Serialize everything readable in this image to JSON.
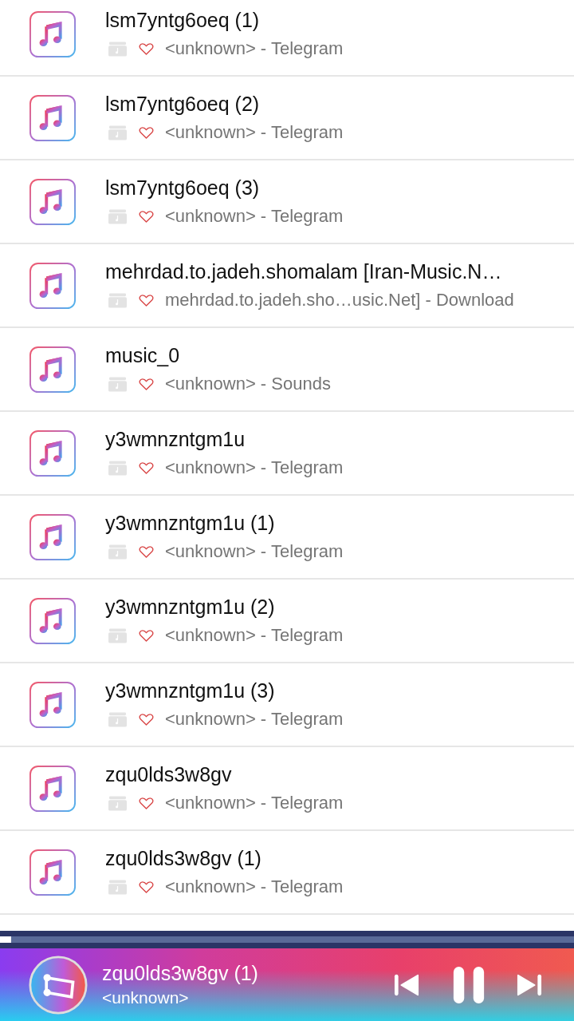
{
  "songs": [
    {
      "title": "lsm7yntg6oeq (1)",
      "subtitle": "<unknown> - Telegram"
    },
    {
      "title": "lsm7yntg6oeq (2)",
      "subtitle": "<unknown> - Telegram"
    },
    {
      "title": "lsm7yntg6oeq (3)",
      "subtitle": "<unknown> - Telegram"
    },
    {
      "title": "mehrdad.to.jadeh.shomalam [Iran-Music.N…",
      "subtitle": "mehrdad.to.jadeh.sho…usic.Net] - Download"
    },
    {
      "title": "music_0",
      "subtitle": "<unknown> - Sounds"
    },
    {
      "title": "y3wmnzntgm1u",
      "subtitle": "<unknown> - Telegram"
    },
    {
      "title": "y3wmnzntgm1u (1)",
      "subtitle": "<unknown> - Telegram"
    },
    {
      "title": "y3wmnzntgm1u (2)",
      "subtitle": "<unknown> - Telegram"
    },
    {
      "title": "y3wmnzntgm1u (3)",
      "subtitle": "<unknown> - Telegram"
    },
    {
      "title": "zqu0lds3w8gv",
      "subtitle": "<unknown> - Telegram"
    },
    {
      "title": "zqu0lds3w8gv (1)",
      "subtitle": "<unknown> - Telegram"
    }
  ],
  "player": {
    "title": "zqu0lds3w8gv (1)",
    "artist": "<unknown>",
    "level": 0.02,
    "playing": true
  }
}
